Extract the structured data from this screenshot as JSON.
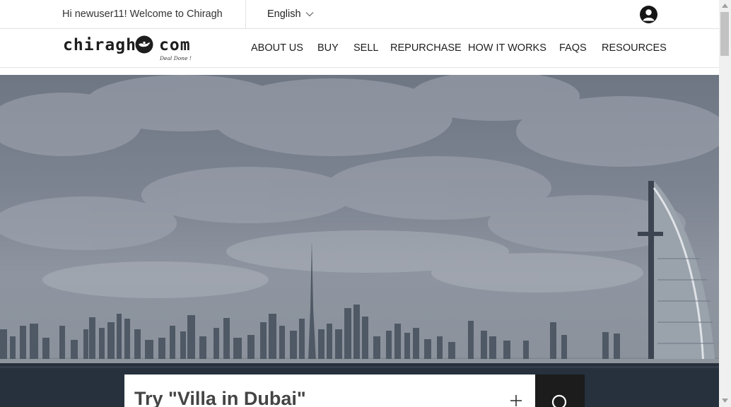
{
  "topbar": {
    "welcome_text": "Hi newuser11! Welcome to Chiragh",
    "language": "English"
  },
  "brand": {
    "logo_word_left": "chiragh",
    "logo_word_right": "com",
    "tagline": "Deal Done !"
  },
  "nav": {
    "items": [
      "ABOUT US",
      "BUY",
      "SELL",
      "REPURCHASE",
      "HOW IT WORKS",
      "FAQS",
      "RESOURCES"
    ]
  },
  "search": {
    "placeholder": "Try \"Villa in Dubai\""
  },
  "icons": {
    "language_dropdown": "chevron-down-icon",
    "account": "user-icon",
    "logo_mark": "lamp-icon",
    "add": "plus-icon",
    "search": "search-icon"
  },
  "colors": {
    "text": "#222222",
    "divider": "#e2e2e2",
    "search_button": "#1c1c1c"
  }
}
